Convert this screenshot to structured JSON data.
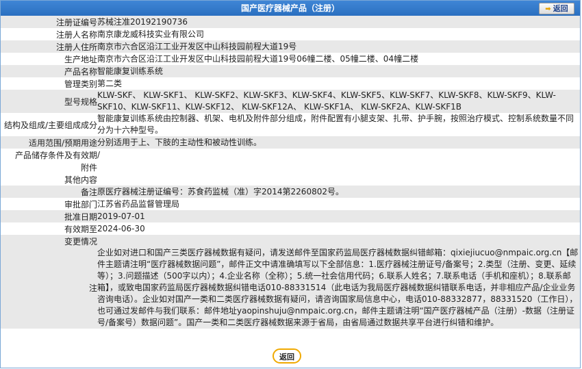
{
  "header": {
    "title": "国产医疗器械产品（注册）",
    "back_label": "返回"
  },
  "rows": [
    {
      "label": "注册证编号",
      "value": "苏械注准20192190736"
    },
    {
      "label": "注册人名称",
      "value": "南京康龙威科技实业有限公司"
    },
    {
      "label": "注册人住所",
      "value": "南京市六合区沿江工业开发区中山科技园前程大道19号"
    },
    {
      "label": "生产地址",
      "value": "南京市六合区沿江工业开发区中山科技园前程大道19号06幢二楼、05幢二楼、04幢二楼"
    },
    {
      "label": "产品名称",
      "value": "智能康复训练系统"
    },
    {
      "label": "管理类别",
      "value": "第二类"
    },
    {
      "label": "型号规格",
      "value": "KLW-SKF、 KLW-SKF1、 KLW-SKF2、KLW-SKF3、KLW-SKF4、KLW-SKF5、KLW-SKF7、KLW-SKF8、KLW-SKF9、KLW-SKF10、KLW-SKF11、KLW-SKF12、 KLW-SKF12A、 KLW-SKF1A、 KLW-SKF2A、KLW-SKF1B"
    },
    {
      "label": "结构及组成/主要组成成分",
      "value": "智能康复训练系统由控制器、机架、电机及附件部分组成，附件配置有小腿支架、扎带、护手腕，按照治疗模式、控制系统数量不同分为十六种型号。"
    },
    {
      "label": "适用范围/预期用途",
      "value": "分别适用于上、下肢的主动性和被动性训练。"
    },
    {
      "label": "产品储存条件及有效期",
      "value": "/"
    },
    {
      "label": "附件",
      "value": ""
    },
    {
      "label": "其他内容",
      "value": ""
    },
    {
      "label": "备注",
      "value": "原医疗器械注册证编号：苏食药监械（准）字2014第2260802号。"
    },
    {
      "label": "审批部门",
      "value": "江苏省药品监督管理局"
    },
    {
      "label": "批准日期",
      "value": "2019-07-01"
    },
    {
      "label": "有效期至",
      "value": "2024-06-30"
    },
    {
      "label": "变更情况",
      "value": ""
    }
  ],
  "note": {
    "label": "注",
    "text": "企业如对进口和国产三类医疗器械数据有疑问，请发送邮件至国家药监局医疗器械数据纠错邮箱：qixiejiucuo@nmpaic.org.cn【邮件主题请注明“医疗器械数据问题”，邮件正文中请准确填写以下全部信息：1.医疗器械注册证号/备案号；2.类型（注册、变更、延续等）；3.问题描述（500字以内）；4.企业名称（全称）；5.统一社会信用代码；6.联系人姓名；7.联系电话（手机和座机）；8.联系邮箱】，或致电国家药监局医疗器械数据纠错电话010-88331514（此电话为我局医疗器械数据纠错联系电话，并非相应产品/企业业务咨询电话）。企业如对国产一类和二类医疗器械数据有疑问，请咨询国家局信息中心，电话010-88332877，88331520（工作日），也可通过发邮件与我们联系：邮件地址yaopinshuju@nmpaic.org.cn，邮件主题请注明“国产医疗器械产品（注册）-数据（注册证号/备案号）数据问题”。国产一类和二类医疗器械数据来源于省局，由省局通过数据共享平台进行纠错和维护。"
  },
  "footer": {
    "back_label": "返回"
  }
}
